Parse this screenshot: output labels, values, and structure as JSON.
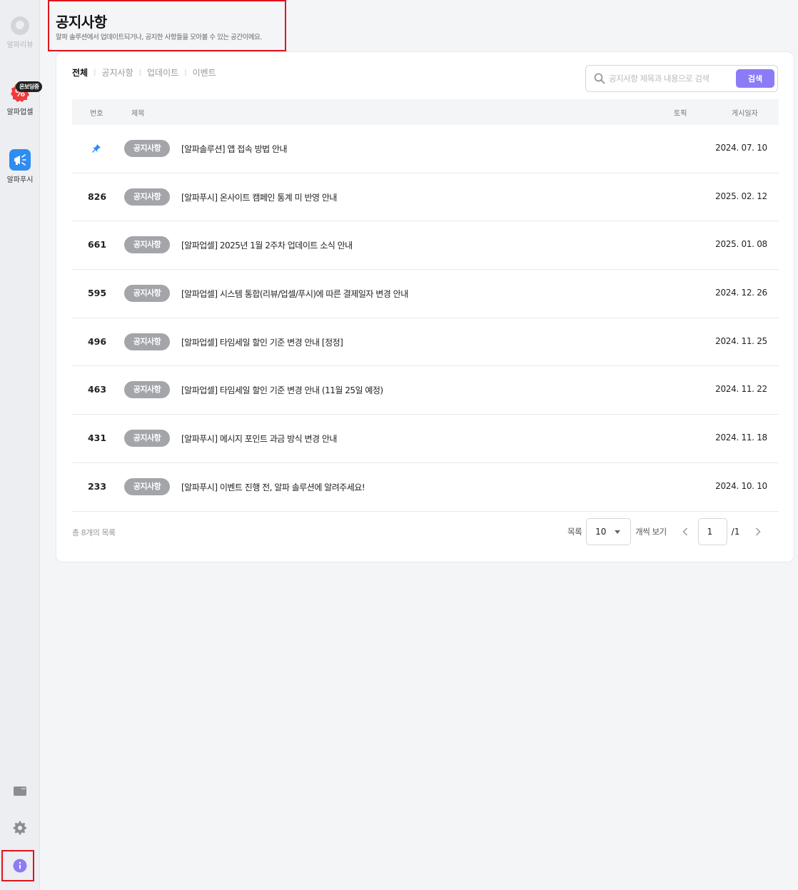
{
  "sidebar": {
    "items": [
      {
        "label": "알파리뷰",
        "icon": "alpha-review-icon"
      },
      {
        "label": "알파업셀",
        "icon": "alpha-upsell-icon",
        "badge": "온보딩중"
      },
      {
        "label": "알파푸시",
        "icon": "alpha-push-icon"
      }
    ],
    "bottom_icons": [
      "chat-icon",
      "gear-icon",
      "info-icon"
    ]
  },
  "header": {
    "title": "공지사항",
    "subtitle": "알파 솔루션에서 업데이트되거나, 공지한 사항들을 모아볼 수 있는 공간이에요."
  },
  "tabs": [
    {
      "label": "전체",
      "active": true
    },
    {
      "label": "공지사항",
      "active": false
    },
    {
      "label": "업데이트",
      "active": false
    },
    {
      "label": "이벤트",
      "active": false
    }
  ],
  "search": {
    "placeholder": "공지사항 제목과 내용으로 검색",
    "value": "",
    "button_label": "검색"
  },
  "table": {
    "headers": {
      "number": "번호",
      "title": "제목",
      "topic": "토픽",
      "date": "게시일자"
    },
    "rows": [
      {
        "number": "",
        "pinned": true,
        "tag": "공지사항",
        "title": "[알파솔루션] 앱 접속 방법 안내",
        "date": "2024. 07. 10"
      },
      {
        "number": "826",
        "tag": "공지사항",
        "title": "[알파푸시] 온사이트 캠페인 통계 미 반영 안내",
        "date": "2025. 02. 12"
      },
      {
        "number": "661",
        "tag": "공지사항",
        "title": "[알파업셀] 2025년 1월 2주차 업데이트 소식 안내",
        "date": "2025. 01. 08"
      },
      {
        "number": "595",
        "tag": "공지사항",
        "title": "[알파업셀] 시스템 통합(리뷰/업셀/푸시)에 따른 결제일자 변경 안내",
        "date": "2024. 12. 26"
      },
      {
        "number": "496",
        "tag": "공지사항",
        "title": "[알파업셀] 타임세일 할인 기준 변경 안내 [정정]",
        "date": "2024. 11. 25"
      },
      {
        "number": "463",
        "tag": "공지사항",
        "title": "[알파업셀] 타임세일 할인 기준 변경 안내 (11월 25일 예정)",
        "date": "2024. 11. 22"
      },
      {
        "number": "431",
        "tag": "공지사항",
        "title": "[알파푸시] 메시지 포인트 과금 방식 변경 안내",
        "date": "2024. 11. 18"
      },
      {
        "number": "233",
        "tag": "공지사항",
        "title": "[알파푸시] 이벤트 진행 전, 알파 솔루션에 알려주세요!",
        "date": "2024. 10. 10"
      }
    ]
  },
  "footer": {
    "total_text": "총 8개의 목록",
    "per_page_label": "목록",
    "per_page_value": "10",
    "per_page_suffix": "개씩 보기",
    "current_page": "1",
    "total_pages": "/1"
  },
  "colors": {
    "accent": "#8b7cf6",
    "highlight_box": "#e0141e",
    "tag_bg": "#a3a5aa",
    "upsell_red": "#ef3b3b",
    "push_blue": "#2f8cf0"
  }
}
